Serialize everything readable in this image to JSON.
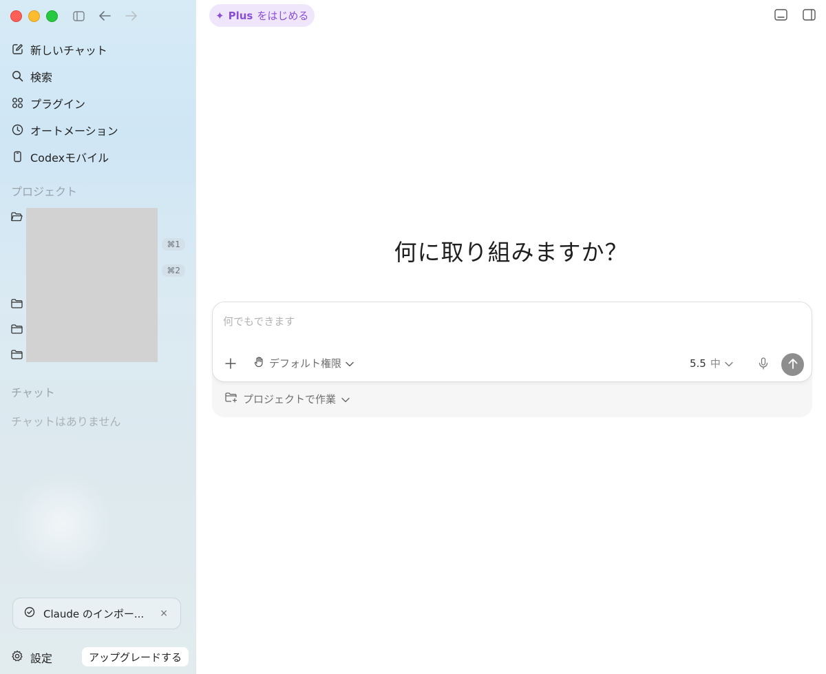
{
  "window": {
    "controls": [
      "close",
      "minimize",
      "zoom"
    ]
  },
  "sidebar": {
    "nav": [
      {
        "label": "新しいチャット",
        "icon": "edit-icon"
      },
      {
        "label": "検索",
        "icon": "search-icon"
      },
      {
        "label": "プラグイン",
        "icon": "grid-icon"
      },
      {
        "label": "オートメーション",
        "icon": "clock-icon"
      },
      {
        "label": "Codexモバイル",
        "icon": "phone-icon"
      }
    ],
    "projects_title": "プロジェクト",
    "project_shortcuts": [
      "⌘1",
      "⌘2"
    ],
    "chats_title": "チャット",
    "chats_empty": "チャットはありません",
    "notice": {
      "text": "Claude のインポー...",
      "close": "×"
    },
    "settings_label": "設定",
    "upgrade_label": "アップグレードする"
  },
  "main": {
    "plus_pill": {
      "star": "✦",
      "plus": "Plus",
      "rest": "をはじめる"
    },
    "headline": "何に取り組みますか？",
    "composer": {
      "placeholder": "何でもできます",
      "permission_label": "デフォルト権限",
      "model_version": "5.5",
      "model_level": "中"
    },
    "project_work_label": "プロジェクトで作業"
  },
  "colors": {
    "accent_purple": "#8a4fd6",
    "pill_bg": "#efe6fb",
    "send_button": "#8e8e8e"
  }
}
